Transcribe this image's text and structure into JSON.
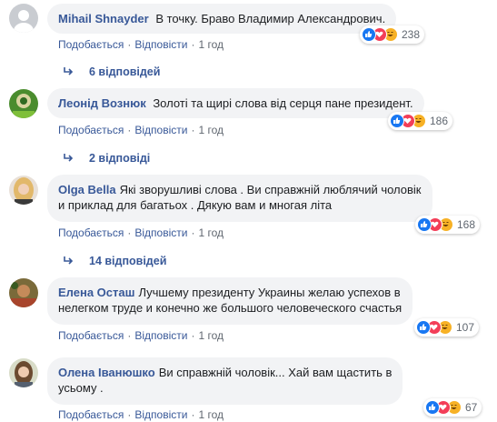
{
  "colors": {
    "link": "#385898",
    "bubble": "#f2f3f5",
    "like": "#1877f2",
    "love": "#f33e58",
    "haha": "#f7b125"
  },
  "comments": [
    {
      "author": "Mihail Shnayder",
      "text": "В точку. Браво Владимир Александрович.",
      "text2": "",
      "like": "Подобається",
      "reply": "Відповісти",
      "time": "1 год",
      "reactions": "238",
      "replies": "6 відповідей",
      "avatar": "generic-avatar-icon"
    },
    {
      "author": "Леонід Вознюк",
      "text": "Золоті та щирі слова від серця пане президент.",
      "text2": "",
      "like": "Подобається",
      "reply": "Відповісти",
      "time": "1 год",
      "reactions": "186",
      "replies": "2 відповіді",
      "avatar": "photo-avatar-icon"
    },
    {
      "author": "Olga Bella",
      "text": "Які зворушливі слова . Ви справжній люблячий чоловік",
      "text2": "и приклад для багатьох . Дякую вам и многая літа",
      "like": "Подобається",
      "reply": "Відповісти",
      "time": "1 год",
      "reactions": "168",
      "replies": "14 відповідей",
      "avatar": "photo-avatar-icon"
    },
    {
      "author": "Елена Осташ",
      "text": "Лучшему президенту Украины желаю успехов в",
      "text2": "нелегком труде и конечно же большого человеческого счастья",
      "like": "Подобається",
      "reply": "Відповісти",
      "time": "1 год",
      "reactions": "107",
      "replies": "",
      "avatar": "photo-avatar-icon"
    },
    {
      "author": "Олена Іванюшко",
      "text": "Ви справжній чоловік... Хай вам щастить в",
      "text2": "усьому .",
      "like": "Подобається",
      "reply": "Відповісти",
      "time": "1 год",
      "reactions": "67",
      "replies": "",
      "avatar": "photo-avatar-icon"
    }
  ]
}
